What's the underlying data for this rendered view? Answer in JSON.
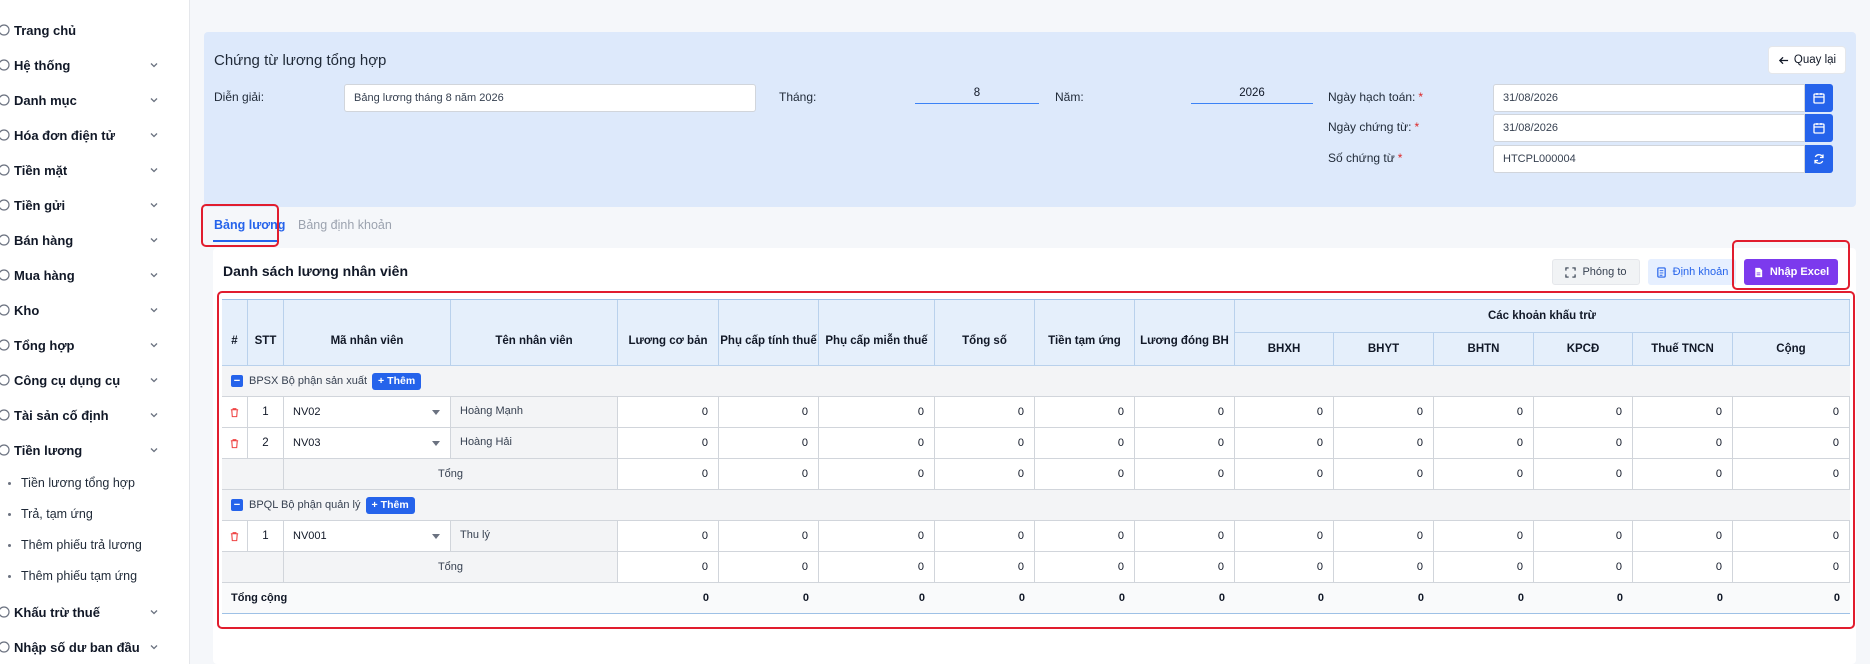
{
  "sidebar": {
    "items": [
      {
        "label": "Trang chủ",
        "icon": "home-icon",
        "has_children": false
      },
      {
        "label": "Hệ thống",
        "icon": "gear-icon",
        "has_children": true
      },
      {
        "label": "Danh mục",
        "icon": "grid-icon",
        "has_children": true
      },
      {
        "label": "Hóa đơn điện tử",
        "icon": "invoice-icon",
        "has_children": true
      },
      {
        "label": "Tiền mặt",
        "icon": "cash-icon",
        "has_children": true
      },
      {
        "label": "Tiền gửi",
        "icon": "bank-icon",
        "has_children": true
      },
      {
        "label": "Bán hàng",
        "icon": "sales-icon",
        "has_children": true
      },
      {
        "label": "Mua hàng",
        "icon": "cart-icon",
        "has_children": true
      },
      {
        "label": "Kho",
        "icon": "warehouse-icon",
        "has_children": true
      },
      {
        "label": "Tổng hợp",
        "icon": "chart-icon",
        "has_children": true
      },
      {
        "label": "Công cụ dụng cụ",
        "icon": "tools-icon",
        "has_children": true
      },
      {
        "label": "Tài sản cố định",
        "icon": "asset-icon",
        "has_children": true
      },
      {
        "label": "Tiền lương",
        "icon": "salary-icon",
        "has_children": true
      }
    ],
    "sub_items": [
      "Tiền lương tổng hợp",
      "Trả, tạm ứng",
      "Thêm phiếu trả lương",
      "Thêm phiếu tạm ứng"
    ],
    "bottom_items": [
      {
        "label": "Khấu trừ thuế",
        "icon": "tax-icon",
        "has_children": true
      },
      {
        "label": "Nhập số dư ban đầu",
        "icon": "balance-icon",
        "has_children": true
      }
    ]
  },
  "header": {
    "title": "Chứng từ lương tổng hợp",
    "back_label": "Quay lại",
    "dien_giai_label": "Diễn giải:",
    "dien_giai_value": "Bảng lương tháng 8 năm 2026",
    "thang_label": "Tháng:",
    "thang_value": "8",
    "nam_label": "Năm:",
    "nam_value": "2026",
    "ngay_hach_toan_label": "Ngày hạch toán:",
    "ngay_hach_toan_value": "31/08/2026",
    "ngay_chung_tu_label": "Ngày chứng từ:",
    "ngay_chung_tu_value": "31/08/2026",
    "so_chung_tu_label": "Số chứng từ",
    "so_chung_tu_value": "HTCPL000004",
    "required_mark": "*"
  },
  "tabs": [
    {
      "label": "Bảng lương",
      "active": true
    },
    {
      "label": "Bảng định khoản",
      "active": false
    }
  ],
  "content": {
    "title": "Danh sách lương nhân viên",
    "btn_zoom": "Phóng to",
    "btn_dinh_khoan": "Định khoản",
    "btn_import": "Nhập Excel"
  },
  "table": {
    "headers": {
      "hash": "#",
      "stt": "STT",
      "ma_nv": "Mã nhân viên",
      "ten_nv": "Tên nhân viên",
      "luong_co_ban": "Lương cơ bản",
      "phu_cap_tinh_thue": "Phụ cấp tính thuế",
      "phu_cap_mien_thue": "Phụ cấp miễn thuế",
      "tong_so": "Tổng số",
      "tien_tam_ung": "Tiền tạm ứng",
      "luong_dong_bh": "Lương đóng BH",
      "khau_tru_group": "Các khoản khấu trừ",
      "bhxh": "BHXH",
      "bhyt": "BHYT",
      "bhtn": "BHTN",
      "kpcd": "KPCĐ",
      "thue_tncn": "Thuế TNCN",
      "cong": "Cộng"
    },
    "add_label": "Thêm",
    "groups": [
      {
        "label": "BPSX Bộ phận sản xuất",
        "rows": [
          {
            "stt": "1",
            "ma_nv": "NV02",
            "ten_nv": "Hoàng Mạnh",
            "values": [
              "0",
              "0",
              "0",
              "0",
              "0",
              "0",
              "0",
              "0",
              "0",
              "0",
              "0",
              "0"
            ]
          },
          {
            "stt": "2",
            "ma_nv": "NV03",
            "ten_nv": "Hoàng Hải",
            "values": [
              "0",
              "0",
              "0",
              "0",
              "0",
              "0",
              "0",
              "0",
              "0",
              "0",
              "0",
              "0"
            ]
          }
        ],
        "total_label": "Tổng",
        "total_values": [
          "0",
          "0",
          "0",
          "0",
          "0",
          "0",
          "0",
          "0",
          "0",
          "0",
          "0",
          "0"
        ]
      },
      {
        "label": "BPQL Bộ phận quản lý",
        "rows": [
          {
            "stt": "1",
            "ma_nv": "NV001",
            "ten_nv": "Thu lý",
            "values": [
              "0",
              "0",
              "0",
              "0",
              "0",
              "0",
              "0",
              "0",
              "0",
              "0",
              "0",
              "0"
            ]
          }
        ],
        "total_label": "Tổng",
        "total_values": [
          "0",
          "0",
          "0",
          "0",
          "0",
          "0",
          "0",
          "0",
          "0",
          "0",
          "0",
          "0"
        ]
      }
    ],
    "grand_total_label": "Tổng cộng",
    "grand_total_values": [
      "0",
      "0",
      "0",
      "0",
      "0",
      "0",
      "0",
      "0",
      "0",
      "0",
      "0",
      "0"
    ]
  },
  "colors": {
    "accent": "#2563eb",
    "import_button": "#7c3aed",
    "highlight": "#e11d2e",
    "header_bg": "#dde9fb"
  }
}
